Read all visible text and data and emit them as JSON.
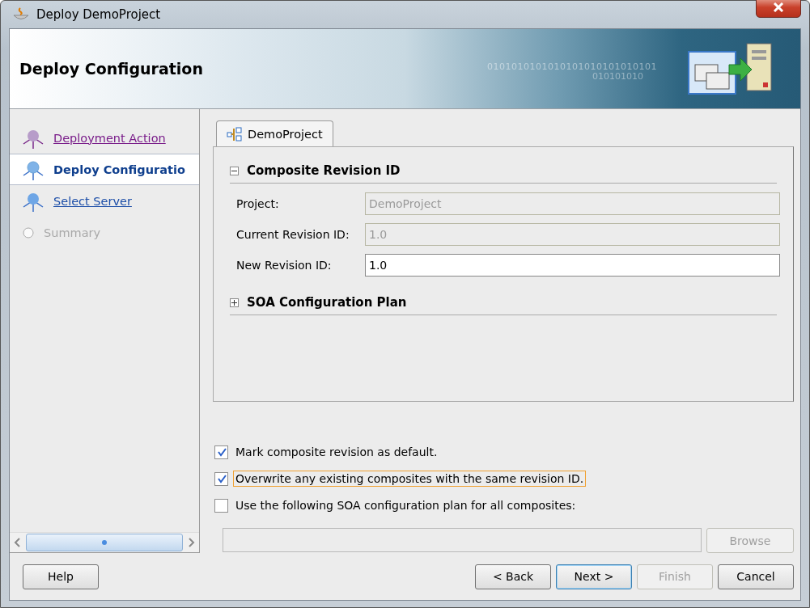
{
  "window": {
    "title": "Deploy DemoProject"
  },
  "header": {
    "title": "Deploy Configuration",
    "banner_text": "0101010101010101010101010101",
    "banner_text_2": "010101010"
  },
  "steps": [
    {
      "label": "Deployment Action",
      "kind": "visited",
      "selected": false
    },
    {
      "label": "Deploy Configuratio",
      "kind": "current",
      "selected": true
    },
    {
      "label": "Select Server",
      "kind": "available",
      "selected": false
    },
    {
      "label": "Summary",
      "kind": "disabled",
      "selected": false
    }
  ],
  "tab": {
    "label": "DemoProject",
    "selected": true
  },
  "sections": [
    {
      "title": "Composite Revision ID",
      "expanded": true,
      "fields": [
        {
          "label": "Project:",
          "value": "DemoProject",
          "disabled": true
        },
        {
          "label": "Current Revision ID:",
          "value": "1.0",
          "disabled": true
        },
        {
          "label": "New Revision ID:",
          "value": "1.0",
          "disabled": false
        }
      ]
    },
    {
      "title": "SOA Configuration Plan",
      "expanded": false
    }
  ],
  "options": [
    {
      "label": "Mark composite revision as default.",
      "checked": true,
      "focused": false
    },
    {
      "label": "Overwrite any existing composites with the same revision ID.",
      "checked": true,
      "focused": true
    },
    {
      "label": "Use the following SOA configuration plan for all composites:",
      "checked": false,
      "focused": false
    }
  ],
  "plan_field": {
    "disabled": true
  },
  "browse_button": {
    "label": "Browse",
    "disabled": true
  },
  "buttons": [
    {
      "label": "Help",
      "kind": "left",
      "disabled": false,
      "default": false
    },
    {
      "label": "< Back",
      "kind": "right",
      "disabled": false,
      "default": false
    },
    {
      "label": "Next >",
      "kind": "right",
      "disabled": false,
      "default": true
    },
    {
      "label": "Finish",
      "kind": "right",
      "disabled": true,
      "default": false
    },
    {
      "label": "Cancel",
      "kind": "right",
      "disabled": false,
      "default": false
    }
  ]
}
